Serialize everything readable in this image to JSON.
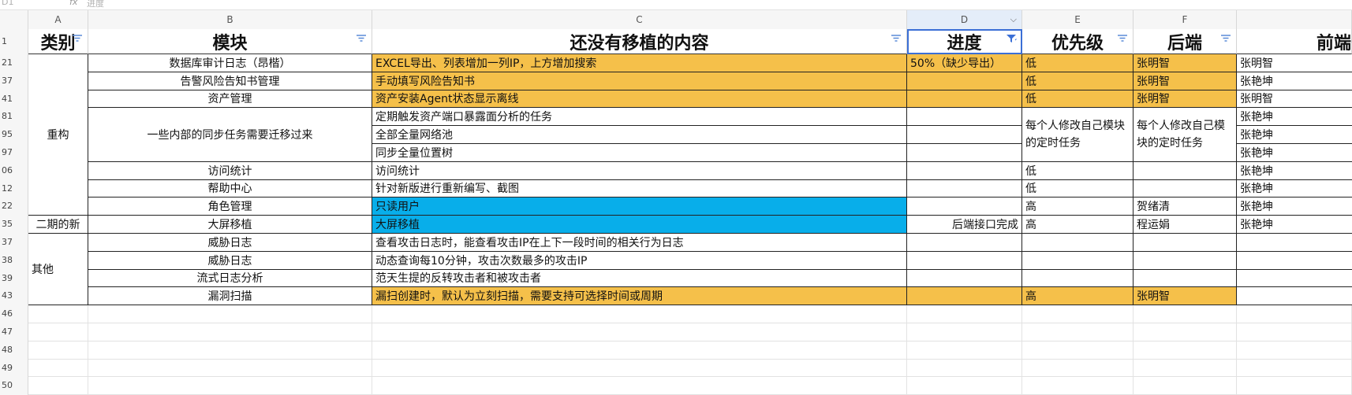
{
  "formula_bar": {
    "cell_ref": "D1",
    "fx": "fx",
    "value": "进度"
  },
  "columns": [
    "A",
    "B",
    "C",
    "D",
    "E",
    "F",
    "G"
  ],
  "header": {
    "category": "类别",
    "module": "模块",
    "content": "还没有移植的内容",
    "progress": "进度",
    "priority": "优先级",
    "backend": "后端",
    "frontend": "前端"
  },
  "row_numbers": [
    "1",
    "21",
    "37",
    "41",
    "81",
    "95",
    "97",
    "06",
    "12",
    "22",
    "35",
    "37",
    "38",
    "39",
    "43",
    "46",
    "47",
    "48",
    "49",
    "50"
  ],
  "categories": {
    "rebuild": "重构",
    "phase2": "二期的新",
    "other": "其他"
  },
  "rows": [
    {
      "module": "数据库审计日志（昂楷）",
      "content": "EXCEL导出、列表增加一列IP，上方增加搜索",
      "progress": "50%（缺少导出）",
      "priority": "低",
      "backend": "张明智",
      "frontend": "张明智"
    },
    {
      "module": "告警风险告知书管理",
      "content": "手动填写风险告知书",
      "progress": "",
      "priority": "低",
      "backend": "张明智",
      "frontend": "张艳坤"
    },
    {
      "module": "资产管理",
      "content": "资产安装Agent状态显示离线",
      "progress": "",
      "priority": "低",
      "backend": "张明智",
      "frontend": "张明智"
    },
    {
      "module": "一些内部的同步任务需要迁移过来",
      "content": "定期触发资产端口暴露面分析的任务",
      "progress": "",
      "priority": "每个人修改自己模块的定时任务",
      "backend": "每个人修改自己模块的定时任务",
      "frontend": "张艳坤"
    },
    {
      "module": "",
      "content": "全部全量网络池",
      "progress": "",
      "priority": "",
      "backend": "",
      "frontend": "张艳坤"
    },
    {
      "module": "",
      "content": "同步全量位置树",
      "progress": "",
      "priority": "",
      "backend": "",
      "frontend": "张艳坤"
    },
    {
      "module": "访问统计",
      "content": "访问统计",
      "progress": "",
      "priority": "低",
      "backend": "",
      "frontend": "张艳坤"
    },
    {
      "module": "帮助中心",
      "content": "针对新版进行重新编写、截图",
      "progress": "",
      "priority": "低",
      "backend": "",
      "frontend": "张艳坤"
    },
    {
      "module": "角色管理",
      "content": "只读用户",
      "progress": "",
      "priority": "高",
      "backend": "贺绪清",
      "frontend": "张艳坤"
    },
    {
      "module": "大屏移植",
      "content": "大屏移植",
      "progress": "后端接口完成",
      "priority": "高",
      "backend": "程运娟",
      "frontend": "张艳坤"
    },
    {
      "module": "威胁日志",
      "content": "查看攻击日志时，能查看攻击IP在上下一段时间的相关行为日志",
      "progress": "",
      "priority": "",
      "backend": "",
      "frontend": ""
    },
    {
      "module": "威胁日志",
      "content": "动态查询每10分钟，攻击次数最多的攻击IP",
      "progress": "",
      "priority": "",
      "backend": "",
      "frontend": ""
    },
    {
      "module": "流式日志分析",
      "content": "范天生提的反转攻击者和被攻击者",
      "progress": "",
      "priority": "",
      "backend": "",
      "frontend": ""
    },
    {
      "module": "漏洞扫描",
      "content": "漏扫创建时，默认为立刻扫描，需要支持可选择时间或周期",
      "progress": "",
      "priority": "高",
      "backend": "张明智",
      "frontend": ""
    }
  ],
  "colors": {
    "orange": "#f5c04a",
    "blue": "#08aeea",
    "active_header": "#e4edf9"
  },
  "icons": {
    "filter": "filter-icon",
    "filter_active": "filter-active-icon",
    "dropdown": "chevron-down-icon"
  }
}
